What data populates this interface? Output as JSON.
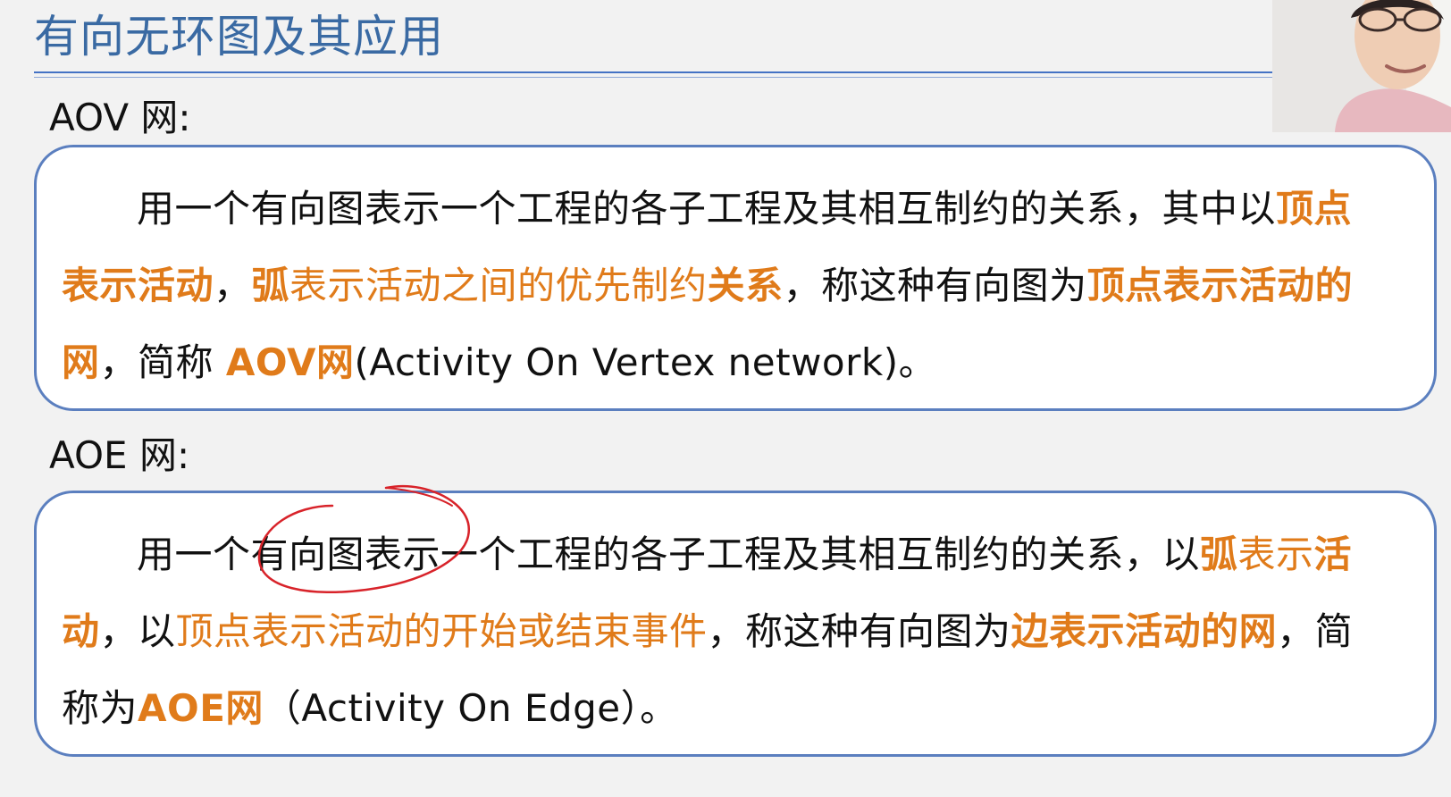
{
  "slide": {
    "title": "有向无环图及其应用"
  },
  "aov": {
    "label": "AOV 网:",
    "p1": "用一个有向图表示一个工程的各子工程及其相互制约的关系，其中以",
    "p2": "顶点表示活动",
    "p3": "，",
    "p4": "弧",
    "p5": "表示活动之间的优先制约",
    "p6": "关系",
    "p7": "，称这种有向图为",
    "p8": "顶点表示活动的网",
    "p9": "，简称 ",
    "p10": "AOV网",
    "p11": "(Activity On Vertex network)。"
  },
  "aoe": {
    "label": "AOE 网:",
    "p1": "用一个有向图表示一个工程的各子工程及其相互制约的关系，以",
    "p2": "弧",
    "p3": "表示",
    "p4": "活动",
    "p5": "，以",
    "p6": "顶点表示活动的开始或结束事件",
    "p7": "，称这种有向图为",
    "p8": "边表示活动的网",
    "p9": "，简称为",
    "p10": "AOE网",
    "p11": "（Activity  On  Edge）。"
  },
  "colors": {
    "title": "#3a6aa3",
    "highlight": "#e07b1a",
    "box_border": "#5b7fbf",
    "annotation": "#d8232a"
  },
  "icons": {
    "webcam": "presenter-webcam-overlay",
    "annotation": "red-pen-circle-annotation"
  }
}
